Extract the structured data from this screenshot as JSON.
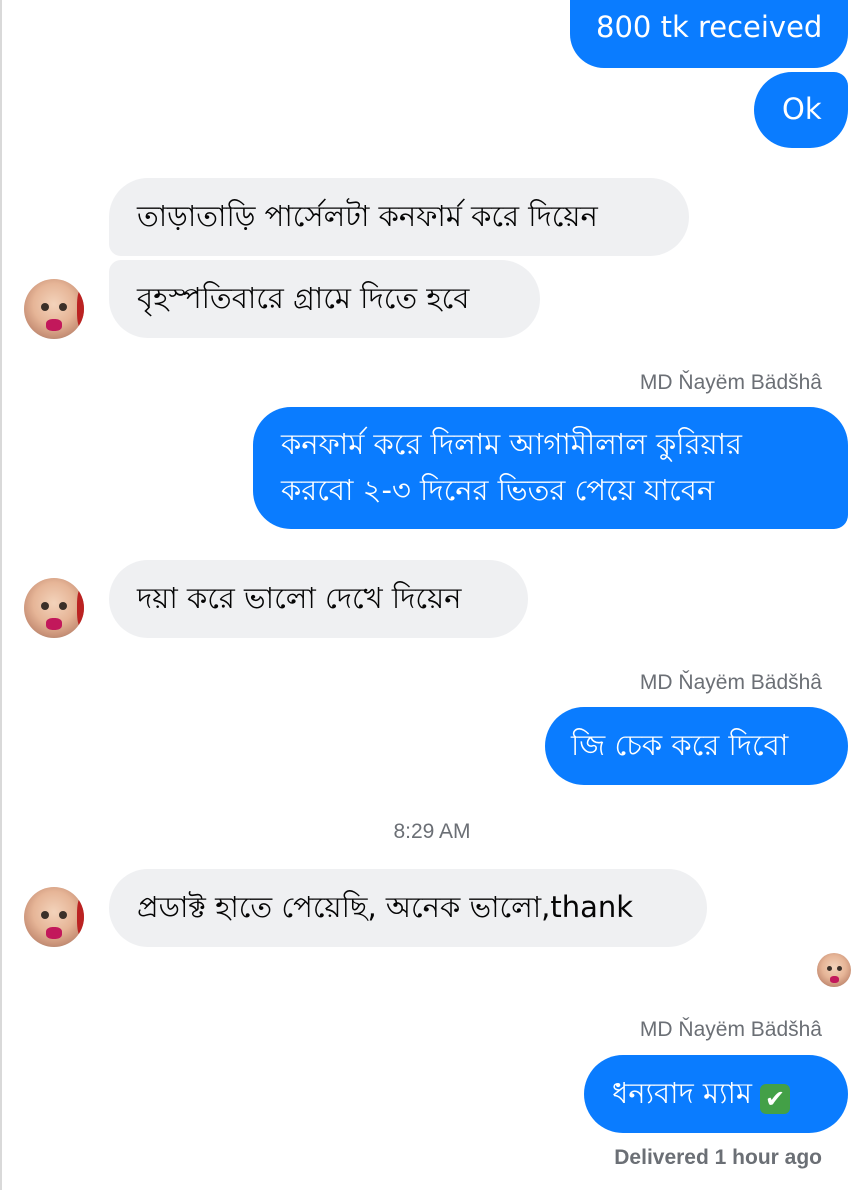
{
  "messages": {
    "m1": "800 tk received",
    "m2": "Ok",
    "m3": "তাড়াতাড়ি পার্সেলটা কনফার্ম করে দিয়েন",
    "m4": "বৃহস্পতিবারে গ্রামে দিতে হবে",
    "sender1": "MD Ňayëm Bädšhâ",
    "m5_line1": "কনফার্ম করে দিলাম আগামীলাল কুরিয়ার",
    "m5_line2": "করবো ২-৩ দিনের ভিতর পেয়ে যাবেন",
    "m6": "দয়া করে ভালো দেখে দিয়েন",
    "sender2": "MD Ňayëm Bädšhâ",
    "m7": "জি চেক করে দিবো",
    "timestamp": "8:29 AM",
    "m8": "প্রডাক্ট হাতে পেয়েছি, অনেক ভালো,thank",
    "sender3": "MD Ňayëm Bädšhâ",
    "m9": "ধন্যবাদ ম্যাম",
    "m9_emoji": "✔"
  },
  "status": "Delivered 1 hour ago",
  "icons": {
    "avatar": "baby-avatar-icon",
    "check": "check-mark-icon"
  },
  "colors": {
    "outgoing_bubble": "#0a7cff",
    "incoming_bubble": "#eff0f2",
    "meta_text": "#6b6f75"
  }
}
